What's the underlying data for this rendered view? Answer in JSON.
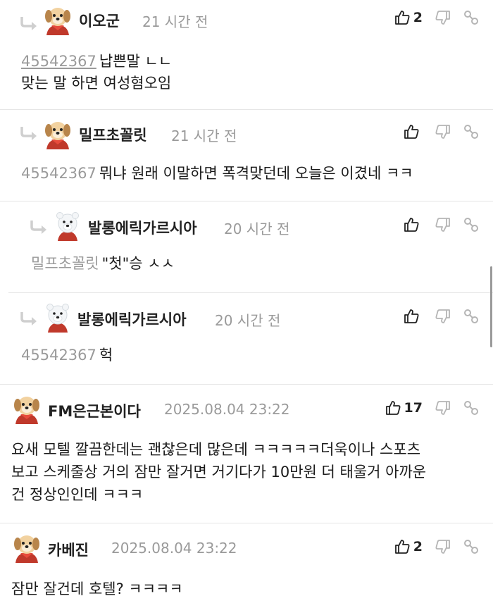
{
  "comments": [
    {
      "nickname": "이오군",
      "time": "21 시간 전",
      "likes": "2",
      "mention": "45542367",
      "text_lines": [
        "납쁜말 ㄴㄴ",
        "맞는 말 하면 여성혐오임"
      ],
      "avatar": "puppy-avatar-icon"
    },
    {
      "nickname": "밀프초꼴릿",
      "time": "21 시간 전",
      "likes": "",
      "mention": "45542367",
      "text_lines": [
        "뭐냐 원래 이말하면 폭격맞던데 오늘은 이겼네 ㅋㅋ"
      ],
      "avatar": "puppy-avatar-icon"
    },
    {
      "nickname": "발롱에릭가르시아",
      "time": "20 시간 전",
      "likes": "",
      "mention": "밀프초꼴릿",
      "text_lines": [
        "\"첫\"승 ㅅㅅ"
      ],
      "avatar": "polar-bear-avatar-icon"
    },
    {
      "nickname": "발롱에릭가르시아",
      "time": "20 시간 전",
      "likes": "",
      "mention": "45542367",
      "text_lines": [
        "헉"
      ],
      "avatar": "polar-bear-avatar-icon"
    },
    {
      "nickname": "FM은근본이다",
      "time": "2025.08.04 23:22",
      "likes": "17",
      "mention": "",
      "text_lines": [
        "요새 모텔 깔끔한데는 괜찮은데 많은데 ㅋㅋㅋㅋㅋ더욱이나 스포츠",
        "보고 스케줄상 거의 잠만 잘거면 거기다가 10만원 더 태울거 아까운",
        "건 정상인인데 ㅋㅋㅋ"
      ],
      "avatar": "puppy-avatar-icon"
    },
    {
      "nickname": "카베진",
      "time": "2025.08.04 23:22",
      "likes": "2",
      "mention": "",
      "text_lines": [
        "잠만 잘건데 호텔? ㅋㅋㅋㅋ"
      ],
      "avatar": "puppy-avatar-icon"
    }
  ]
}
